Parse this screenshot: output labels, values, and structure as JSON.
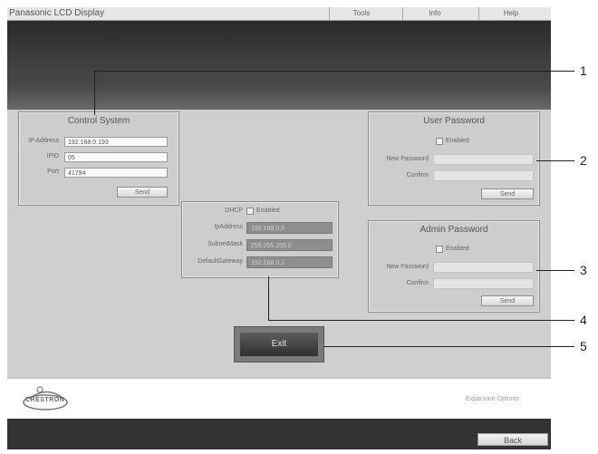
{
  "app": {
    "title": "Panasonic LCD Display"
  },
  "menu": {
    "items": [
      "Tools",
      "Info",
      "Help"
    ]
  },
  "control_system": {
    "title": "Control System",
    "ip_address_label": "IP Address",
    "ip_address_value": "192.168.0.193",
    "ipid_label": "IPID",
    "ipid_value": "05",
    "port_label": "Port",
    "port_value": "41794",
    "send_label": "Send"
  },
  "network": {
    "dhcp_label": "DHCP",
    "dhcp_enabled_label": "Enabled",
    "ip_address_label": "IpAddress",
    "ip_address_value": "192.168.0.8",
    "subnet_label": "SubnetMask",
    "subnet_value": "255.255.255.0",
    "gateway_label": "DefaultGateway",
    "gateway_value": "192.168.0.1"
  },
  "user_password": {
    "title": "User Password",
    "enabled_label": "Enabled",
    "new_password_label": "New Password",
    "confirm_label": "Confirm",
    "send_label": "Send"
  },
  "admin_password": {
    "title": "Admin Password",
    "enabled_label": "Enabled",
    "new_password_label": "New Password",
    "confirm_label": "Confirm",
    "send_label": "Send"
  },
  "exit": {
    "label": "Exit"
  },
  "footer": {
    "expansion_label": "Expansion Options",
    "logo_text": "CRESTRON"
  },
  "bottom": {
    "back_label": "Back"
  },
  "callouts": [
    "1",
    "2",
    "3",
    "4",
    "5"
  ]
}
